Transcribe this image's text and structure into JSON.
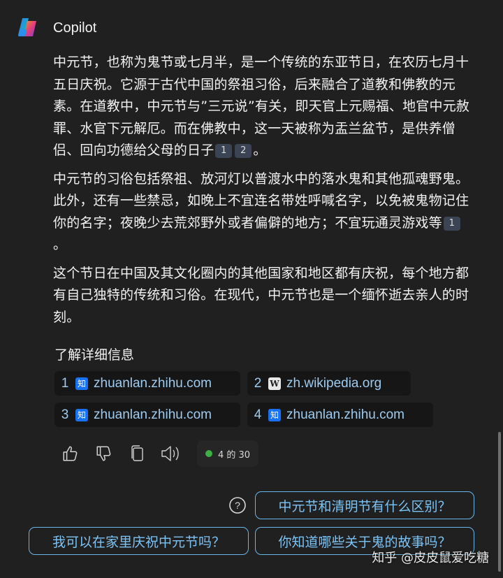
{
  "app": {
    "title": "Copilot"
  },
  "answer": {
    "p1": {
      "text": "中元节，也称为鬼节或七月半，是一个传统的东亚节日，在农历七月十五日庆祝。它源于古代中国的祭祖习俗，后来融合了道教和佛教的元素。在道教中，中元节与”三元说”有关，即天官上元赐福、地官中元赦罪、水官下元解厄。而在佛教中，这一天被称为盂兰盆节，是供养僧侣、回向功德给父母的日子",
      "cites": [
        "1",
        "2"
      ],
      "end": "。"
    },
    "p2": {
      "text": "中元节的习俗包括祭祖、放河灯以普渡水中的落水鬼和其他孤魂野鬼。此外，还有一些禁忌，如晚上不宜连名带姓呼喊名字，以免被鬼物记住你的名字；夜晚少去荒郊野外或者偏僻的地方；不宜玩通灵游戏等",
      "cites": [
        "1"
      ],
      "end": "。"
    },
    "p3": {
      "text": "这个节日在中国及其文化圈内的其他国家和地区都有庆祝，每个地方都有自己独特的传统和习俗。在现代，中元节也是一个缅怀逝去亲人的时刻。"
    }
  },
  "learn_more": {
    "label": "了解详细信息"
  },
  "sources": [
    {
      "num": "1",
      "favicon": "zhihu-icon",
      "favicon_glyph": "知",
      "domain": "zhuanlan.zhihu.com"
    },
    {
      "num": "2",
      "favicon": "wikipedia-icon",
      "favicon_glyph": "W",
      "domain": "zh.wikipedia.org"
    },
    {
      "num": "3",
      "favicon": "zhihu-icon",
      "favicon_glyph": "知",
      "domain": "zhuanlan.zhihu.com"
    },
    {
      "num": "4",
      "favicon": "zhihu-icon",
      "favicon_glyph": "知",
      "domain": "zhuanlan.zhihu.com"
    }
  ],
  "actions": {
    "icons": [
      "thumbs-up-icon",
      "thumbs-down-icon",
      "copy-icon",
      "speaker-icon"
    ],
    "counter": "4 的 30",
    "counter_color": "#3cb043"
  },
  "suggestions": [
    "中元节和清明节有什么区别？",
    "我可以在家里庆祝中元节吗？",
    "你知道哪些关于鬼的故事吗？"
  ],
  "watermark": "知乎 @皮皮鼠爱吃糖",
  "colors": {
    "background": "#202020",
    "link": "#9ecbf0",
    "chip_border": "#6ab6e8",
    "citation_bg": "#3a4454"
  }
}
